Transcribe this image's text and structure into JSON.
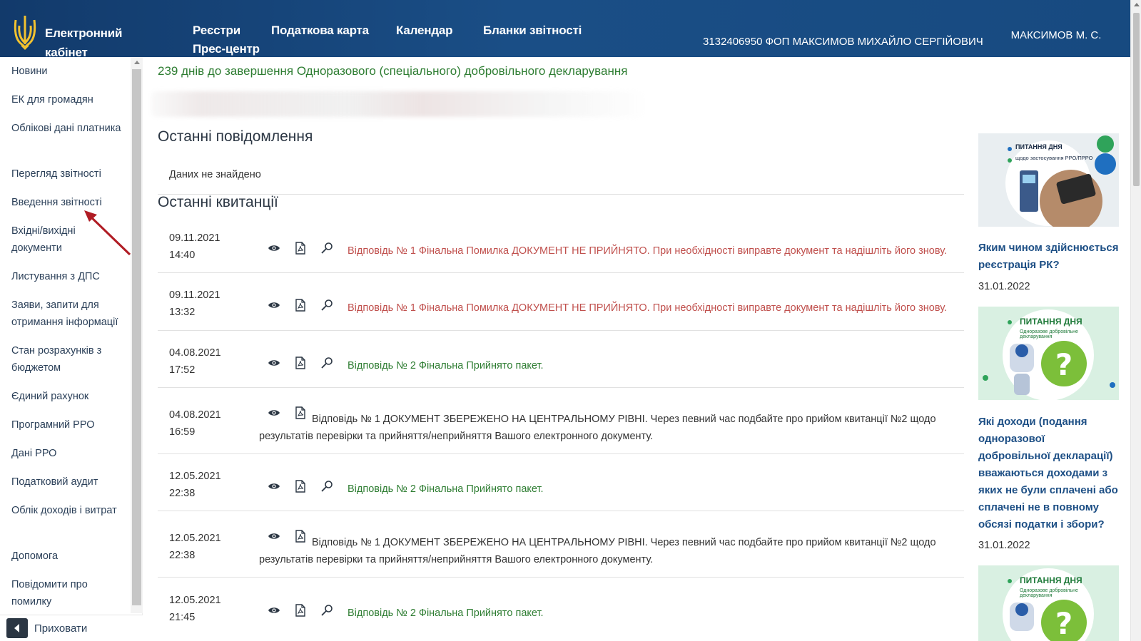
{
  "header": {
    "brand": "Електронний кабінет",
    "nav": [
      "Реєстри",
      "Податкова карта",
      "Календар",
      "Бланки звітності",
      "Прес-центр"
    ],
    "user_info": "3132406950 ФОП МАКСИМОВ МИХАЙЛО СЕРГІЙОВИЧ",
    "user_name": "МАКСИМОВ М. С."
  },
  "sidebar": {
    "items": [
      "Новини",
      "ЕК для громадян",
      "Облікові дані платника",
      "Перегляд звітності",
      "Введення звітності",
      "Вхідні/вихідні документи",
      "Листування з ДПС",
      "Заяви, запити для отримання інформації",
      "Стан розрахунків з бюджетом",
      "Єдиний рахунок",
      "Програмний РРО",
      "Дані РРО",
      "Податковий аудит",
      "Облік доходів і витрат",
      "Допомога",
      "Повідомити про помилку"
    ],
    "hide_label": "Приховати"
  },
  "main": {
    "banner": "239 днів до завершення Одноразового (спеціального) добровільного декларування",
    "messages_title": "Останні повідомлення",
    "no_data": "Даних не знайдено",
    "receipts_title": "Останні квитанції",
    "receipts": [
      {
        "date": "09.11.2021",
        "time": "14:40",
        "status": "error",
        "text": "Відповідь № 1 Фінальна Помилка ДОКУМЕНТ НЕ ПРИЙНЯТО. При необхідності виправте документ та надішліть його знову."
      },
      {
        "date": "09.11.2021",
        "time": "13:32",
        "status": "error",
        "text": "Відповідь № 1 Фінальна Помилка ДОКУМЕНТ НЕ ПРИЙНЯТО. При необхідності виправте документ та надішліть його знову."
      },
      {
        "date": "04.08.2021",
        "time": "17:52",
        "status": "ok",
        "text": "Відповідь № 2 Фінальна Прийнято пакет."
      },
      {
        "date": "04.08.2021",
        "time": "16:59",
        "status": "info",
        "text": "Відповідь № 1 ДОКУМЕНТ ЗБЕРЕЖЕНО НА ЦЕНТРАЛЬНОМУ РІВНІ. Через певний час подбайте про прийом квитанції №2 щодо результатів перевірки та прийняття/неприйняття Вашого електронного документу."
      },
      {
        "date": "12.05.2021",
        "time": "22:38",
        "status": "ok",
        "text": "Відповідь № 2 Фінальна Прийнято пакет."
      },
      {
        "date": "12.05.2021",
        "time": "22:38",
        "status": "info",
        "text": "Відповідь № 1 ДОКУМЕНТ ЗБЕРЕЖЕНО НА ЦЕНТРАЛЬНОМУ РІВНІ. Через певний час подбайте про прийом квитанції №2 щодо результатів перевірки та прийняття/неприйняття Вашого електронного документу."
      },
      {
        "date": "12.05.2021",
        "time": "21:45",
        "status": "ok",
        "text": "Відповідь № 2 Фінальна Прийнято пакет."
      }
    ]
  },
  "news": [
    {
      "img_title": "ПИТАННЯ ДНЯ",
      "img_subtitle": "щодо застосування РРО/ПРРО",
      "title": "Яким чином здійснюється реєстрація РК?",
      "date": "31.01.2022"
    },
    {
      "img_title": "ПИТАННЯ ДНЯ",
      "img_subtitle": "Одноразове добровільне декларування",
      "title": "Які доходи (подання одноразової добровільної декларації) вважаються доходами з яких не були сплачені або сплачені не в повному обсязі податки і збори?",
      "date": "31.01.2022"
    },
    {
      "img_title": "ПИТАННЯ ДНЯ",
      "img_subtitle": "Одноразове добровільне декларування",
      "title": "",
      "date": ""
    }
  ],
  "colors": {
    "header": "#1a4e86",
    "error": "#c0504d",
    "ok": "#2e7d32",
    "link": "#1d4f85"
  }
}
